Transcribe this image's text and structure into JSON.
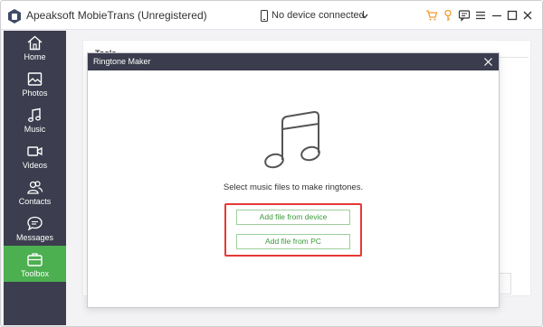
{
  "app": {
    "title": "Apeaksoft MobieTrans (Unregistered)",
    "device_status": "No device connected"
  },
  "titlebar_icons": [
    "cart-icon",
    "key-icon",
    "feedback-icon",
    "menu-icon",
    "minimize-icon",
    "maximize-icon",
    "close-icon"
  ],
  "sidebar": {
    "active_index": 6,
    "items": [
      {
        "label": "Home",
        "icon": "home-icon"
      },
      {
        "label": "Photos",
        "icon": "photo-icon"
      },
      {
        "label": "Music",
        "icon": "music-note-icon"
      },
      {
        "label": "Videos",
        "icon": "video-camera-icon"
      },
      {
        "label": "Contacts",
        "icon": "contacts-icon"
      },
      {
        "label": "Messages",
        "icon": "message-icon"
      },
      {
        "label": "Toolbox",
        "icon": "toolbox-icon"
      }
    ]
  },
  "main": {
    "section_title": "Tools"
  },
  "dialog": {
    "title": "Ringtone Maker",
    "prompt": "Select music files to make ringtones.",
    "add_from_device": "Add file from device",
    "add_from_pc": "Add file from PC"
  },
  "colors": {
    "sidebar_bg": "#3c3d4e",
    "active_green": "#4caf50",
    "accent_orange": "#f39c34",
    "highlight_red": "#e53935",
    "button_text_green": "#3a9a3a"
  }
}
